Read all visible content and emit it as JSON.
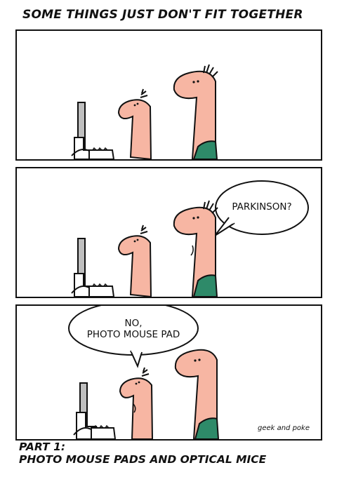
{
  "title": "SOME THINGS JUST DON'T FIT TOGETHER",
  "panels": [
    {
      "speech": null
    },
    {
      "speech": "PARKINSON?"
    },
    {
      "speech_line1": "NO,",
      "speech_line2": "PHOTO MOUSE PAD"
    }
  ],
  "signature": "geek and poke",
  "caption": {
    "line1": "PART 1:",
    "line2": "PHOTO MOUSE PADS AND OPTICAL MICE"
  },
  "colors": {
    "skin": "#f7b6a3",
    "shirt": "#2e8a69",
    "outline": "#111111",
    "monitor": "#bfbfbf"
  }
}
